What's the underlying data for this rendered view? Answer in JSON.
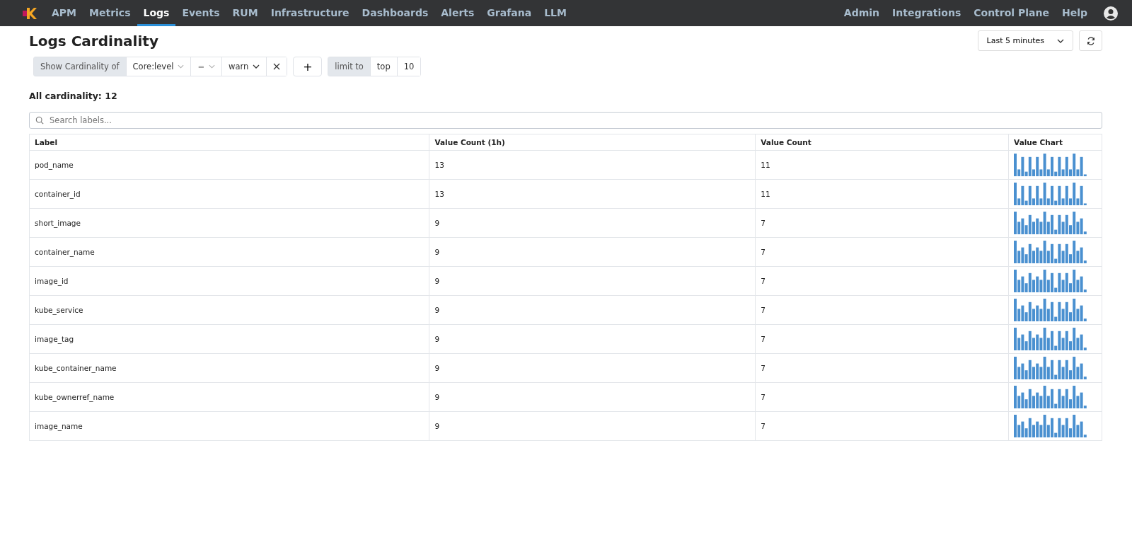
{
  "nav": {
    "items": [
      {
        "label": "APM",
        "selected": false
      },
      {
        "label": "Metrics",
        "selected": false
      },
      {
        "label": "Logs",
        "selected": true
      },
      {
        "label": "Events",
        "selected": false
      },
      {
        "label": "RUM",
        "selected": false
      },
      {
        "label": "Infrastructure",
        "selected": false
      },
      {
        "label": "Dashboards",
        "selected": false
      },
      {
        "label": "Alerts",
        "selected": false
      },
      {
        "label": "Grafana",
        "selected": false
      },
      {
        "label": "LLM",
        "selected": false
      }
    ],
    "right_items": [
      "Admin",
      "Integrations",
      "Control Plane",
      "Help"
    ]
  },
  "page_title": "Logs Cardinality",
  "time_range": "Last 5 minutes",
  "query": {
    "prefix": "Show Cardinality of",
    "field": "Core:level",
    "operator": "=",
    "value": "warn",
    "add": "+",
    "limit_label": "limit to",
    "limit_mode": "top",
    "limit_value": "10"
  },
  "summary": "All cardinality: 12",
  "search": {
    "placeholder": "Search labels..."
  },
  "table": {
    "columns": [
      "Label",
      "Value Count (1h)",
      "Value Count",
      "Value Chart"
    ],
    "rows": [
      {
        "label": "pod_name",
        "count_1h": "13",
        "count": "11"
      },
      {
        "label": "container_id",
        "count_1h": "13",
        "count": "11"
      },
      {
        "label": "short_image",
        "count_1h": "9",
        "count": "7"
      },
      {
        "label": "container_name",
        "count_1h": "9",
        "count": "7"
      },
      {
        "label": "image_id",
        "count_1h": "9",
        "count": "7"
      },
      {
        "label": "kube_service",
        "count_1h": "9",
        "count": "7"
      },
      {
        "label": "image_tag",
        "count_1h": "9",
        "count": "7"
      },
      {
        "label": "kube_container_name",
        "count_1h": "9",
        "count": "7"
      },
      {
        "label": "kube_ownerref_name",
        "count_1h": "9",
        "count": "7"
      },
      {
        "label": "image_name",
        "count_1h": "9",
        "count": "7"
      }
    ]
  }
}
